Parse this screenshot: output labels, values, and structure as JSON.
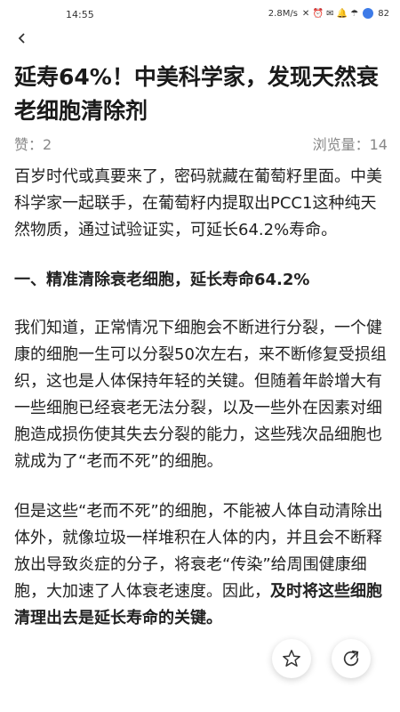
{
  "status": {
    "time": "14:55",
    "network": "2.8M/s",
    "indicators": "✕ ⏰ ✉ 🔔 ☂",
    "battery": "82"
  },
  "nav": {
    "back_icon": "chevron-left-icon"
  },
  "article": {
    "title": "延寿64%！中美科学家，发现天然衰老细胞清除剂",
    "likes": "赞：2",
    "views": "浏览量：14",
    "p1": "百岁时代或真要来了，密码就藏在葡萄籽里面。中美科学家一起联手，在葡萄籽内提取出PCC1这种纯天然物质，通过试验证实，可延长64.2%寿命。",
    "heading1": "一、精准清除衰老细胞，延长寿命64.2%",
    "p2": "我们知道，正常情况下细胞会不断进行分裂，一个健康的细胞一生可以分裂50次左右，来不断修复受损组织，这也是人体保持年轻的关键。但随着年龄增大有一些细胞已经衰老无法分裂，以及一些外在因素对细胞造成损伤使其失去分裂的能力，这些残次品细胞也就成为了“老而不死”的细胞。",
    "p3_normal": "但是这些“老而不死”的细胞，不能被人体自动清除出体外，就像垃圾一样堆积在人体的内，并且会不断释放出导致炎症的分子，将衰老“传染”给周围健康细胞，大加速了人体衰老速度。因此，",
    "p3_bold": "及时将这些细胞清理出去是延长寿命的关键。"
  },
  "actions": {
    "favorite_icon": "star-icon",
    "share_icon": "share-icon"
  }
}
